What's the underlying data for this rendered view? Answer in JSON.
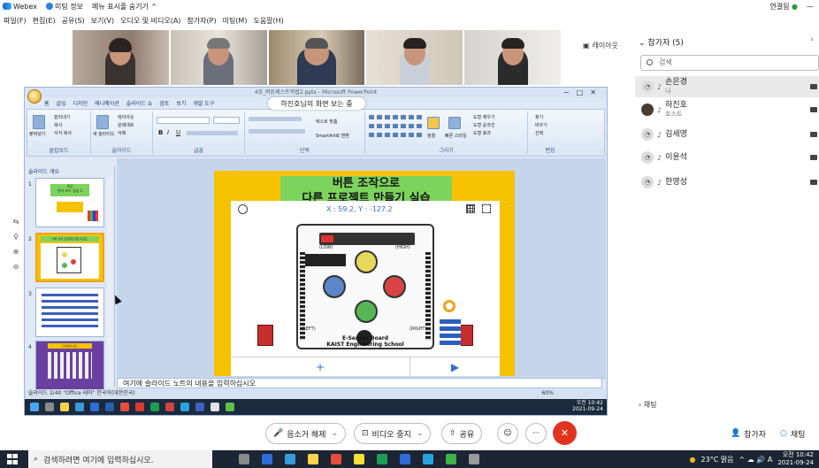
{
  "titlebar": {
    "app": "Webex",
    "meeting_info": "미팅 정보",
    "hide_menu": "메뉴 표시줄 숨기기",
    "hide_menu_chevron": "^",
    "connected": "연결됨",
    "connected_dot": "●"
  },
  "menu": {
    "items": [
      "파일(F)",
      "편집(E)",
      "공유(S)",
      "보기(V)",
      "오디오 및 비디오(A)",
      "참가자(P)",
      "미팅(M)",
      "도움말(H)"
    ]
  },
  "layout_button": "레이아웃",
  "share": {
    "banner": "하진호님의 화면 보는 중",
    "ppt_title": "4강_버튼제스트학법2.pptx - Microsoft PowerPoint",
    "ribbon_tabs": [
      "홈",
      "삽입",
      "디자인",
      "애니메이션",
      "슬라이드 쇼",
      "검토",
      "보기",
      "개발 도구"
    ],
    "ribbon_groups": [
      "클립보드",
      "슬라이드",
      "글꼴",
      "단락",
      "그리기",
      "편집"
    ],
    "ribbon_buttons": {
      "paste": "붙여넣기",
      "cut": "잘라내기",
      "copy": "복사",
      "format_painter": "서식 복사",
      "new_slide": "새 슬라이드",
      "layout": "레이아웃",
      "reset": "원래대로",
      "delete": "삭제",
      "align_text": "텍스트 맞춤",
      "smartart": "SmartArt로 변환",
      "arrange": "정렬",
      "quick_styles": "빠른 스타일",
      "shape_fill": "도형 채우기",
      "shape_outline": "도형 윤곽선",
      "shape_effects": "도형 효과",
      "find": "찾기",
      "replace": "바꾸기",
      "select": "선택"
    },
    "panel_tabs": "슬라이드  개요",
    "thumbnails": [
      {
        "num": "1",
        "text": "4강\n센서 보드 실습 1"
      },
      {
        "num": "2",
        "text": "버튼 센서 프로젝트 정합 리포트"
      },
      {
        "num": "3",
        "text": ""
      },
      {
        "num": "4",
        "text": "드림센서 보드"
      }
    ],
    "slide": {
      "title_line1": "버튼 조작으로",
      "title_line2": "다른 프로젝트 만들기 실습",
      "coord": "X : 59.2, Y : -127.2",
      "board_low": "(LOW)",
      "board_high": "(HIGH)",
      "board_left": "(LEFT)",
      "board_right": "(RIGHT)",
      "board_name": "E-Sensor Board",
      "board_school": "KAIST Engineering School",
      "add": "+",
      "play": "▶"
    },
    "notes": "여기에 슬라이드 노트의 내용을 입력하십시오",
    "status": "슬라이드 2/40   \"Office 테마\"   한국어(대한민국)",
    "status_zoom": "60%",
    "inner_clock_time": "오전 10:42",
    "inner_clock_date": "2021-09-24",
    "side_tool_glyphs": [
      "⇆",
      "♀",
      "⊕",
      "⊖"
    ]
  },
  "participants": {
    "header": "참가자 (5)",
    "close_icon": "›",
    "search_placeholder": "검색",
    "list": [
      {
        "name": "손은경",
        "role": "나"
      },
      {
        "name": "하진호",
        "role": "호스트"
      },
      {
        "name": "김세영",
        "role": ""
      },
      {
        "name": "이윤석",
        "role": ""
      },
      {
        "name": "한영성",
        "role": ""
      }
    ],
    "chat_toggle": "› 채팅"
  },
  "controls": {
    "mute": "음소거 해제",
    "stop_video": "비디오 중지",
    "share": "공유",
    "more": "···",
    "participants": "참가자",
    "chat": "채팅",
    "mute_icon": "🎤",
    "video_icon": "⊡",
    "share_icon": "⇧",
    "reaction_icon": "☺",
    "end_icon": "✕",
    "participants_icon": "👤",
    "chat_icon": "○",
    "chevron": "⌄"
  },
  "taskbar": {
    "search_placeholder": "검색하려면 여기에 입력하십시오.",
    "weather": "23°C 맑음",
    "tray_glyphs": "^ ☁ 🔊 A",
    "time": "오전 10:42",
    "date": "2021-09-24"
  },
  "colors": {
    "slide_bg": "#f6c200",
    "slide_title_bg": "#7dd45d",
    "end_call": "#e0341f",
    "accent_blue": "#2f6fd0",
    "taskbar": "#1c2533"
  }
}
